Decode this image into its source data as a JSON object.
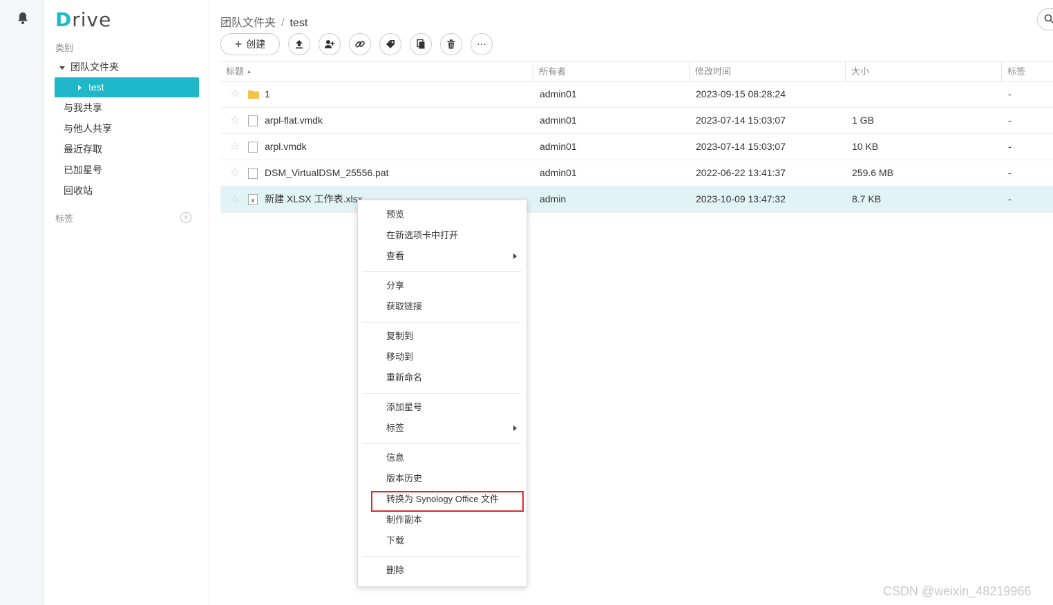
{
  "app": {
    "logo_first": "D",
    "logo_rest": "rive"
  },
  "sidebar": {
    "category_label": "类别",
    "team_folder": "团队文件夹",
    "selected_folder": "test",
    "items": [
      "与我共享",
      "与他人共享",
      "最近存取",
      "已加星号",
      "回收站"
    ],
    "tags_label": "标签"
  },
  "breadcrumb": {
    "root": "团队文件夹",
    "separator": "/",
    "current": "test"
  },
  "toolbar": {
    "create_label": "创建",
    "icons": [
      "upload-icon",
      "share-user-icon",
      "link-icon",
      "tag-icon",
      "copy-icon",
      "delete-icon",
      "more-icon"
    ],
    "more_glyph": "···"
  },
  "table": {
    "headers": [
      "标题",
      "所有者",
      "修改时间",
      "大小",
      "标签"
    ],
    "sort_indicator": "▲",
    "rows": [
      {
        "type": "folder",
        "name": "1",
        "owner": "admin01",
        "modified": "2023-09-15 08:28:24",
        "size": "",
        "tags": "-"
      },
      {
        "type": "file",
        "name": "arpl-flat.vmdk",
        "owner": "admin01",
        "modified": "2023-07-14 15:03:07",
        "size": "1 GB",
        "tags": "-"
      },
      {
        "type": "file",
        "name": "arpl.vmdk",
        "owner": "admin01",
        "modified": "2023-07-14 15:03:07",
        "size": "10 KB",
        "tags": "-"
      },
      {
        "type": "file",
        "name": "DSM_VirtualDSM_25556.pat",
        "owner": "admin01",
        "modified": "2022-06-22 13:41:37",
        "size": "259.6 MB",
        "tags": "-"
      },
      {
        "type": "xlsx",
        "name": "新建 XLSX 工作表.xlsx",
        "owner": "admin",
        "modified": "2023-10-09 13:47:32",
        "size": "8.7 KB",
        "tags": "-",
        "selected": true
      }
    ]
  },
  "context_menu": {
    "groups": [
      [
        {
          "label": "预览"
        },
        {
          "label": "在新选项卡中打开"
        },
        {
          "label": "查看",
          "submenu": true
        }
      ],
      [
        {
          "label": "分享"
        },
        {
          "label": "获取链接"
        }
      ],
      [
        {
          "label": "复制到"
        },
        {
          "label": "移动到"
        },
        {
          "label": "重新命名"
        }
      ],
      [
        {
          "label": "添加星号"
        },
        {
          "label": "标签",
          "submenu": true
        }
      ],
      [
        {
          "label": "信息"
        },
        {
          "label": "版本历史"
        },
        {
          "label": "转换为 Synology Office 文件",
          "highlighted": true
        },
        {
          "label": "制作副本"
        },
        {
          "label": "下载"
        }
      ],
      [
        {
          "label": "删除"
        }
      ]
    ]
  },
  "colors": {
    "accent": "#1fb8cb",
    "selected_row": "#e2f3f6",
    "highlight_box": "#e0282a",
    "folder": "#f7c14a",
    "excel": "#1e8f4e"
  },
  "watermark": "CSDN @weixin_48219966"
}
